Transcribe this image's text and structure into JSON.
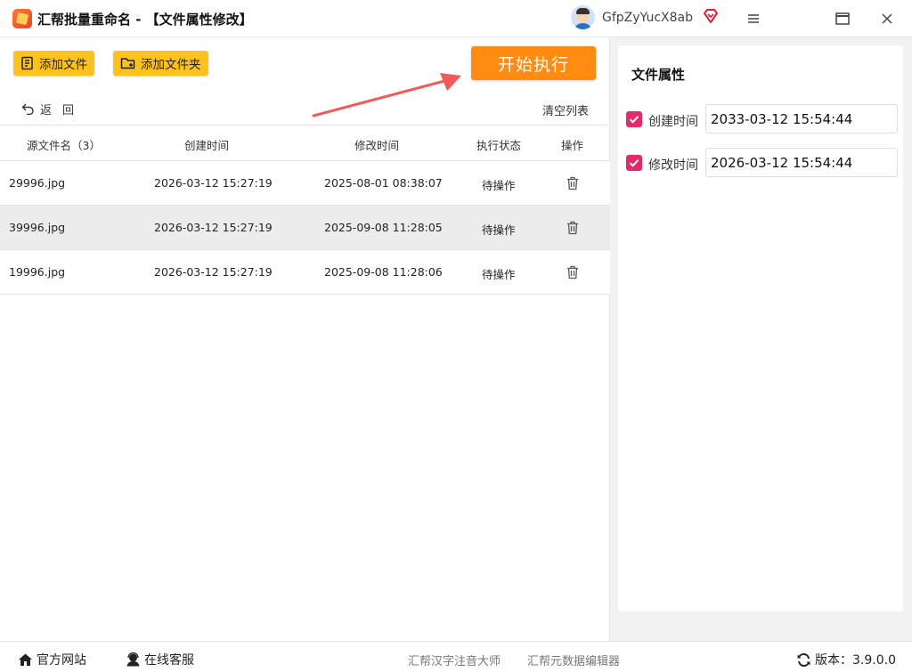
{
  "app": {
    "title": "汇帮批量重命名 - 【文件属性修改】",
    "username": "GfpZyYucX8ab"
  },
  "toolbar": {
    "add_file_label": "添加文件",
    "add_folder_label": "添加文件夹",
    "start_label": "开始执行",
    "back_label": "返回",
    "clear_list_label": "清空列表"
  },
  "table": {
    "headers": {
      "name": "源文件名（3）",
      "created": "创建时间",
      "modified": "修改时间",
      "status": "执行状态",
      "action": "操作"
    },
    "rows": [
      {
        "name": "29996.jpg",
        "created": "2026-03-12 15:27:19",
        "modified": "2025-08-01 08:38:07",
        "status": "待操作"
      },
      {
        "name": "39996.jpg",
        "created": "2026-03-12 15:27:19",
        "modified": "2025-09-08 11:28:05",
        "status": "待操作"
      },
      {
        "name": "19996.jpg",
        "created": "2026-03-12 15:27:19",
        "modified": "2025-09-08 11:28:06",
        "status": "待操作"
      }
    ]
  },
  "properties": {
    "title": "文件属性",
    "created": {
      "label": "创建时间",
      "value": "2033-03-12 15:54:44",
      "checked": true
    },
    "modified": {
      "label": "修改时间",
      "value": "2026-03-12 15:54:44",
      "checked": true
    }
  },
  "statusbar": {
    "website_label": "官方网站",
    "support_label": "在线客服",
    "link1": "汇帮汉字注音大师",
    "link2": "汇帮元数据编辑器",
    "version_label": "版本：3.9.0.0"
  },
  "colors": {
    "accent_yellow": "#ffc21c",
    "start_orange": "#ff8b12",
    "checkbox_pink": "#e32a6a",
    "arrow_red": "#f05a5a"
  },
  "icons": [
    "app-logo-icon",
    "vip-diamond-icon",
    "menu-icon",
    "maximize-icon",
    "close-icon",
    "add-file-icon",
    "add-folder-icon",
    "back-arrow-icon",
    "trash-icon",
    "home-icon",
    "support-icon",
    "refresh-icon"
  ]
}
